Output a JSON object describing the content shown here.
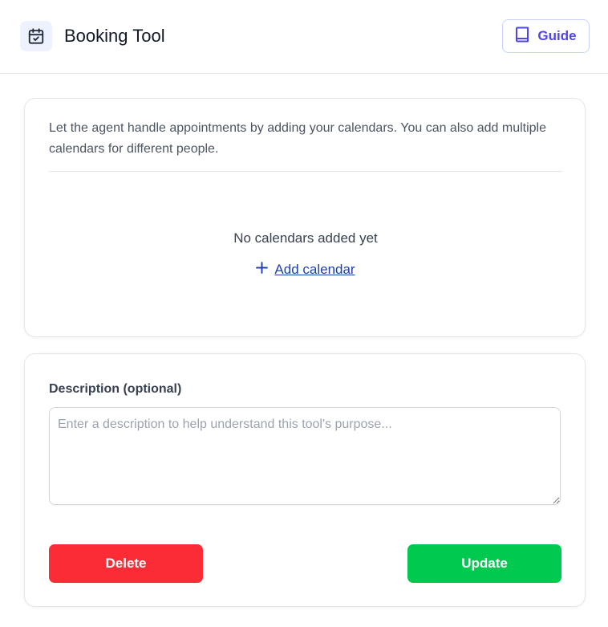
{
  "header": {
    "icon": "calendar-check-icon",
    "title": "Booking Tool",
    "guide_label": "Guide",
    "guide_icon": "book-icon"
  },
  "calendars": {
    "intro": "Let the agent handle appointments by adding your calendars. You can also add multiple calendars for different people.",
    "empty_state": "No calendars added yet",
    "add_label": "Add calendar",
    "add_icon": "plus-icon"
  },
  "description": {
    "label": "Description (optional)",
    "value": "",
    "placeholder": "Enter a description to help understand this tool's purpose..."
  },
  "actions": {
    "delete_label": "Delete",
    "update_label": "Update"
  },
  "colors": {
    "accent": "#4f46e5",
    "link": "#1e40af",
    "delete": "#fb2c36",
    "update": "#00c950"
  }
}
